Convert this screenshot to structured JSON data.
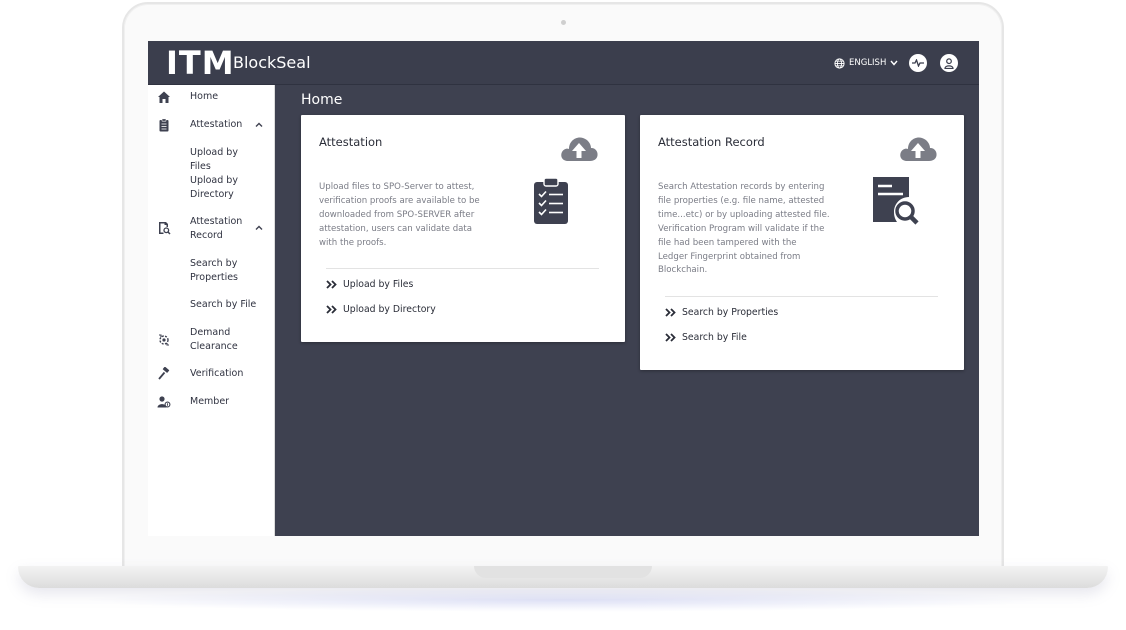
{
  "header": {
    "logo_mark": "ITM",
    "app_name": "BlockSeal",
    "language": "ENGLISH"
  },
  "sidebar": {
    "items": [
      {
        "label": "Home",
        "icon": "home-icon"
      },
      {
        "label": "Attestation",
        "icon": "clipboard-icon",
        "expanded": true
      },
      {
        "label": "Upload by Files",
        "sub": true
      },
      {
        "label": "Upload by Directory",
        "sub": true
      },
      {
        "label": "Attestation Record",
        "icon": "record-search-icon",
        "expanded": true
      },
      {
        "label": "Search by Properties",
        "sub": true
      },
      {
        "label": "Search by File",
        "sub": true
      },
      {
        "label": "Demand Clearance",
        "icon": "clearance-icon"
      },
      {
        "label": "Verification",
        "icon": "gavel-icon"
      },
      {
        "label": "Member",
        "icon": "member-icon"
      }
    ]
  },
  "main": {
    "page_title": "Home",
    "cards": [
      {
        "title": "Attestation",
        "description": [
          "Upload files to SPO-Server to attest,",
          "verification proofs are available to be",
          "downloaded from SPO-SERVER after",
          "attestation, users can validate data",
          "with the proofs."
        ],
        "links": [
          "Upload by Files",
          "Upload by Directory"
        ],
        "icon": "clipboard-checklist-icon"
      },
      {
        "title": "Attestation Record",
        "description": [
          "Search Attestation records by entering",
          "file properties (e.g. file name, attested",
          "time...etc) or by uploading attested file.",
          "Verification Program will validate if the",
          "file had been tampered with the",
          "Ledger Fingerprint obtained from",
          "Blockchain."
        ],
        "links": [
          "Search by Properties",
          "Search by File"
        ],
        "icon": "document-search-icon"
      }
    ]
  },
  "colors": {
    "background": "#3e4150",
    "topbar": "#3b3e4d",
    "sidebar": "#ffffff",
    "icon_gray": "#3e4150",
    "cloud_gray": "#7b7d86"
  }
}
